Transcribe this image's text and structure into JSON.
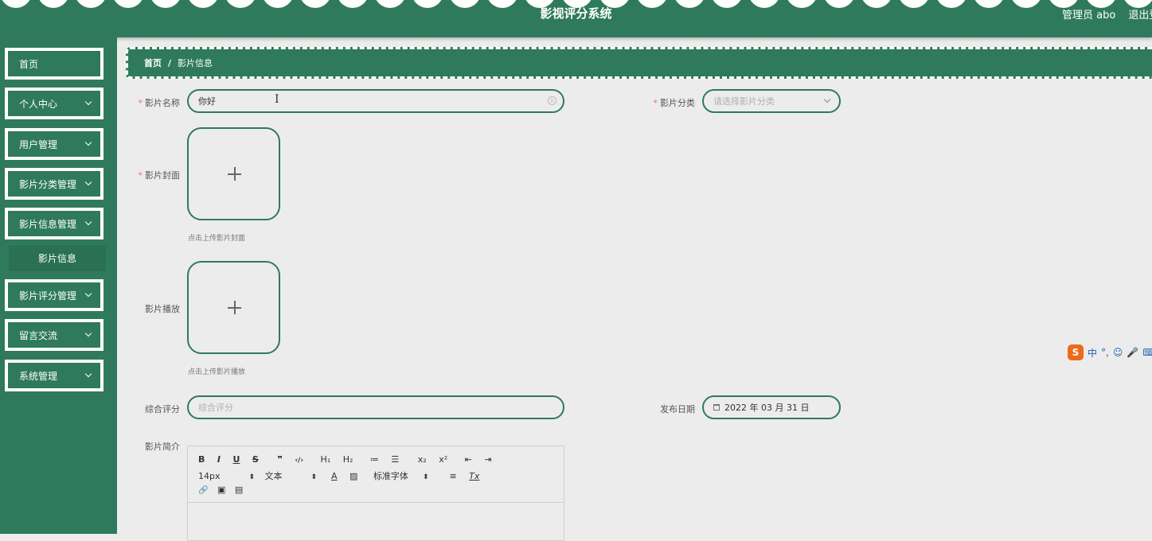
{
  "header": {
    "title": "影视评分系统",
    "admin": "管理员 abo",
    "logout": "退出登"
  },
  "sidebar": {
    "items": [
      {
        "label": "首页",
        "expandable": false
      },
      {
        "label": "个人中心",
        "expandable": true
      },
      {
        "label": "用户管理",
        "expandable": true
      },
      {
        "label": "影片分类管理",
        "expandable": true
      },
      {
        "label": "影片信息管理",
        "expandable": true
      },
      {
        "label": "影片评分管理",
        "expandable": true
      },
      {
        "label": "留言交流",
        "expandable": true
      },
      {
        "label": "系统管理",
        "expandable": true
      }
    ],
    "subitem": "影片信息"
  },
  "breadcrumb": {
    "home": "首页",
    "separator": "/",
    "current": "影片信息"
  },
  "form": {
    "required_mark": "*",
    "name_label": "影片名称",
    "name_value": "你好",
    "category_label": "影片分类",
    "category_placeholder": "请选择影片分类",
    "cover_label": "影片封面",
    "cover_hint": "点击上传影片封面",
    "play_label": "影片播放",
    "play_hint": "点击上传影片播放",
    "score_label": "综合评分",
    "score_placeholder": "综合评分",
    "date_label": "发布日期",
    "date_value": "2022 年 03 月 31 日",
    "intro_label": "影片简介"
  },
  "editor": {
    "row1": [
      "B",
      "I",
      "U",
      "S",
      "❞",
      "‹/›",
      "H₁",
      "H₂",
      "≔",
      "☰",
      "x₂",
      "x²",
      "⇤",
      "⇥"
    ],
    "font_size": "14px",
    "block_type": "文本",
    "font_family": "标准字体",
    "row2_icons": [
      "A",
      "▨",
      "≡",
      "Tx"
    ],
    "row3": [
      "🔗",
      "▣",
      "▤"
    ]
  },
  "ime": {
    "logo": "S",
    "items": [
      "中",
      "°,",
      "☺",
      "🎤",
      "⌨"
    ]
  },
  "colors": {
    "primary": "#2f7a5c",
    "background": "#ececec",
    "required": "#f56c6c"
  },
  "icons": [
    "chevron-down-icon",
    "clear-icon",
    "plus-icon",
    "calendar-icon",
    "text-cursor-icon"
  ]
}
